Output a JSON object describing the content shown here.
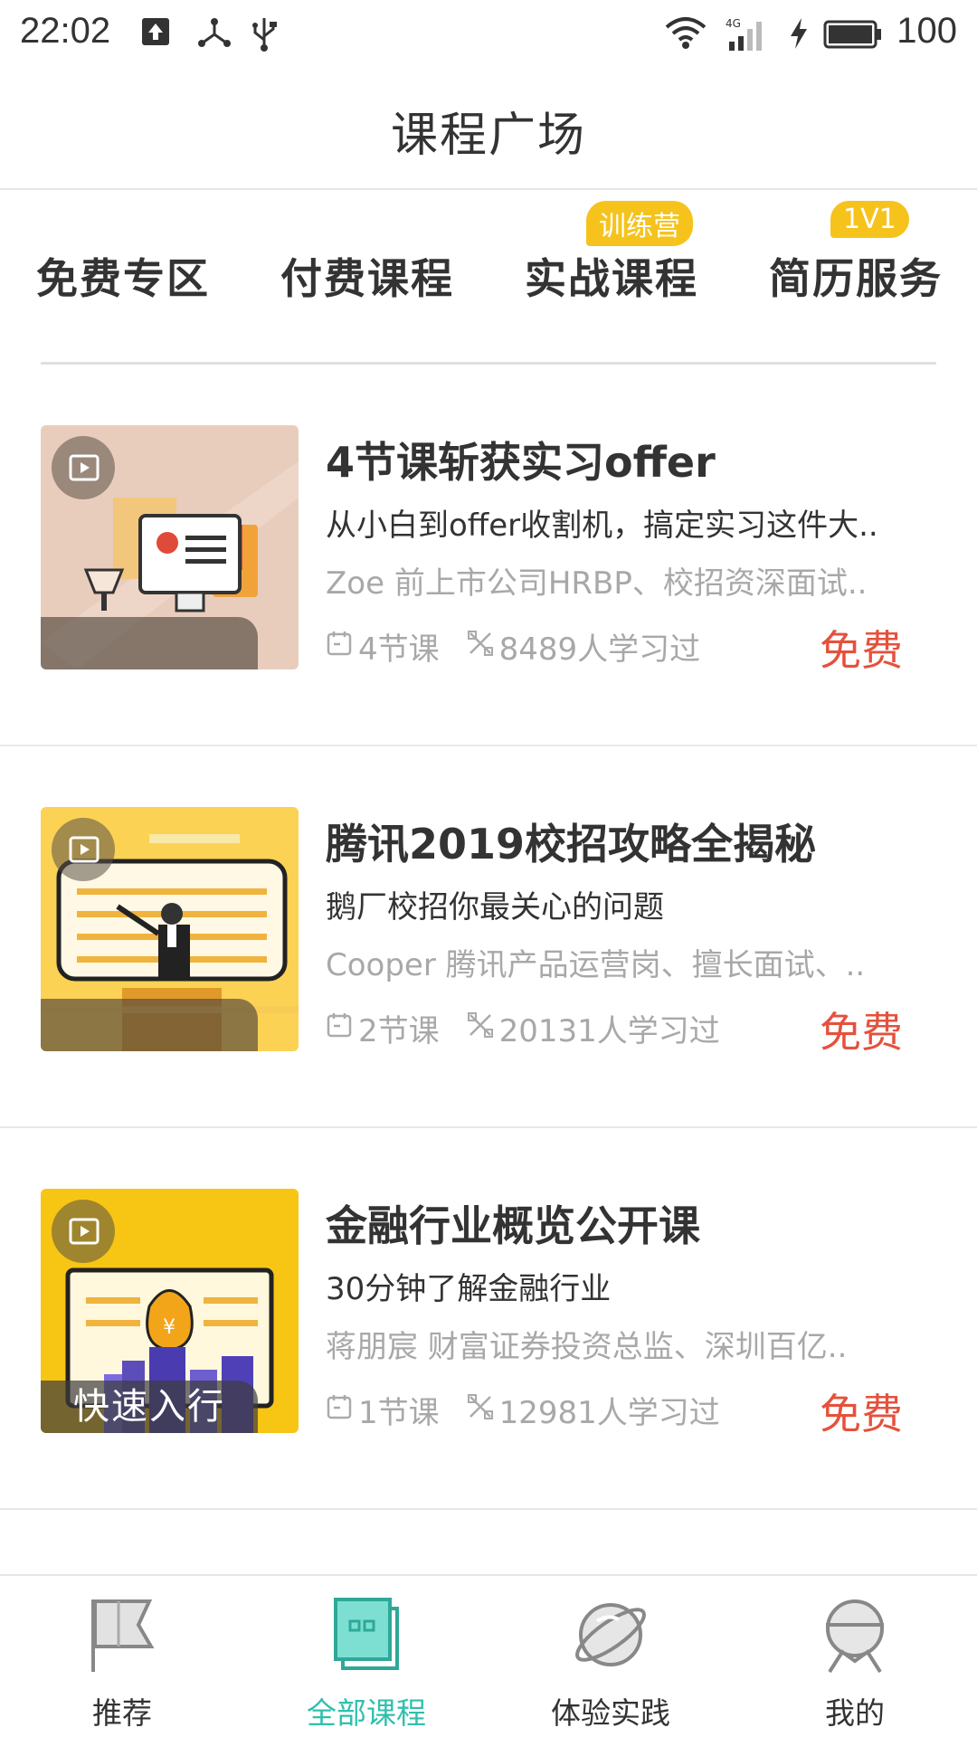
{
  "status_bar": {
    "time": "22:02",
    "battery": "100",
    "icons": [
      "upload-icon",
      "share-icon",
      "usb-icon",
      "wifi-icon",
      "signal-4g-icon",
      "charging-icon",
      "battery-icon"
    ]
  },
  "header": {
    "title": "课程广场"
  },
  "tabs": [
    {
      "label": "免费专区",
      "active": true,
      "badge": ""
    },
    {
      "label": "付费课程",
      "active": false,
      "badge": ""
    },
    {
      "label": "实战课程",
      "active": false,
      "badge": "训练营"
    },
    {
      "label": "简历服务",
      "active": false,
      "badge": "1V1"
    }
  ],
  "courses": [
    {
      "title": "4节课斩获实习offer",
      "subtitle": "从小白到offer收割机，搞定实习这件大..",
      "teacher": "Zoe  前上市公司HRBP、校招资深面试..",
      "lessons": "4节课",
      "learners": "8489人学习过",
      "price": "免费",
      "thumb_tag": ""
    },
    {
      "title": "腾讯2019校招攻略全揭秘",
      "subtitle": "鹅厂校招你最关心的问题",
      "teacher": "Cooper  腾讯产品运营岗、擅长面试、..",
      "lessons": "2节课",
      "learners": "20131人学习过",
      "price": "免费",
      "thumb_tag": ""
    },
    {
      "title": "金融行业概览公开课",
      "subtitle": "30分钟了解金融行业",
      "teacher": "蒋朋宸  财富证券投资总监、深圳百亿..",
      "lessons": "1节课",
      "learners": "12981人学习过",
      "price": "免费",
      "thumb_tag": "快速入行"
    }
  ],
  "bottom_nav": [
    {
      "label": "推荐",
      "icon": "flag-icon",
      "active": false
    },
    {
      "label": "全部课程",
      "icon": "course-book-icon",
      "active": true
    },
    {
      "label": "体验实践",
      "icon": "planet-icon",
      "active": false
    },
    {
      "label": "我的",
      "icon": "user-helmet-icon",
      "active": false
    }
  ],
  "colors": {
    "accent": "#3bd1bd",
    "price": "#e5513c",
    "badge": "#f6c31d",
    "active_nav": "#30c0ad"
  }
}
